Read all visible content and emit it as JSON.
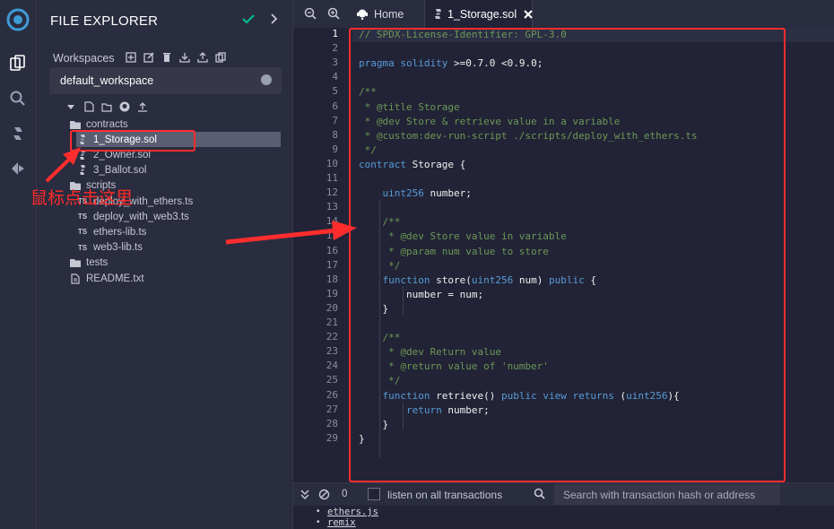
{
  "panel": {
    "title": "FILE EXPLORER",
    "workspaces_label": "Workspaces",
    "workspace_name": "default_workspace"
  },
  "tree": {
    "items": [
      {
        "label": "contracts",
        "kind": "folder"
      },
      {
        "label": "1_Storage.sol",
        "kind": "sol",
        "selected": true
      },
      {
        "label": "2_Owner.sol",
        "kind": "sol"
      },
      {
        "label": "3_Ballot.sol",
        "kind": "sol"
      },
      {
        "label": "scripts",
        "kind": "folder"
      },
      {
        "label": "deploy_with_ethers.ts",
        "kind": "ts"
      },
      {
        "label": "deploy_with_web3.ts",
        "kind": "ts"
      },
      {
        "label": "ethers-lib.ts",
        "kind": "ts"
      },
      {
        "label": "web3-lib.ts",
        "kind": "ts"
      },
      {
        "label": "tests",
        "kind": "folder"
      },
      {
        "label": "README.txt",
        "kind": "txt"
      }
    ],
    "ts_badge": "TS"
  },
  "tabs": {
    "home": "Home",
    "file": "1_Storage.sol"
  },
  "code": {
    "lines": [
      "// SPDX-License-Identifier: GPL-3.0",
      "",
      "pragma solidity >=0.7.0 <0.9.0;",
      "",
      "/**",
      " * @title Storage",
      " * @dev Store & retrieve value in a variable",
      " * @custom:dev-run-script ./scripts/deploy_with_ethers.ts",
      " */",
      "contract Storage {",
      "",
      "    uint256 number;",
      "",
      "    /**",
      "     * @dev Store value in variable",
      "     * @param num value to store",
      "     */",
      "    function store(uint256 num) public {",
      "        number = num;",
      "    }",
      "",
      "    /**",
      "     * @dev Return value",
      "     * @return value of 'number'",
      "     */",
      "    function retrieve() public view returns (uint256){",
      "        return number;",
      "    }",
      "}"
    ]
  },
  "terminal": {
    "count": "0",
    "listen_label": "listen on all transactions",
    "search_placeholder": "Search with transaction hash or address",
    "output": [
      "ethers.js",
      "remix"
    ]
  },
  "annotation": {
    "text": "鼠标点击这里"
  },
  "colors": {
    "accent_red": "#ff2d2d",
    "check_green": "#00bc8c",
    "keyword_blue": "#569cd6",
    "comment_green": "#6a9955"
  }
}
